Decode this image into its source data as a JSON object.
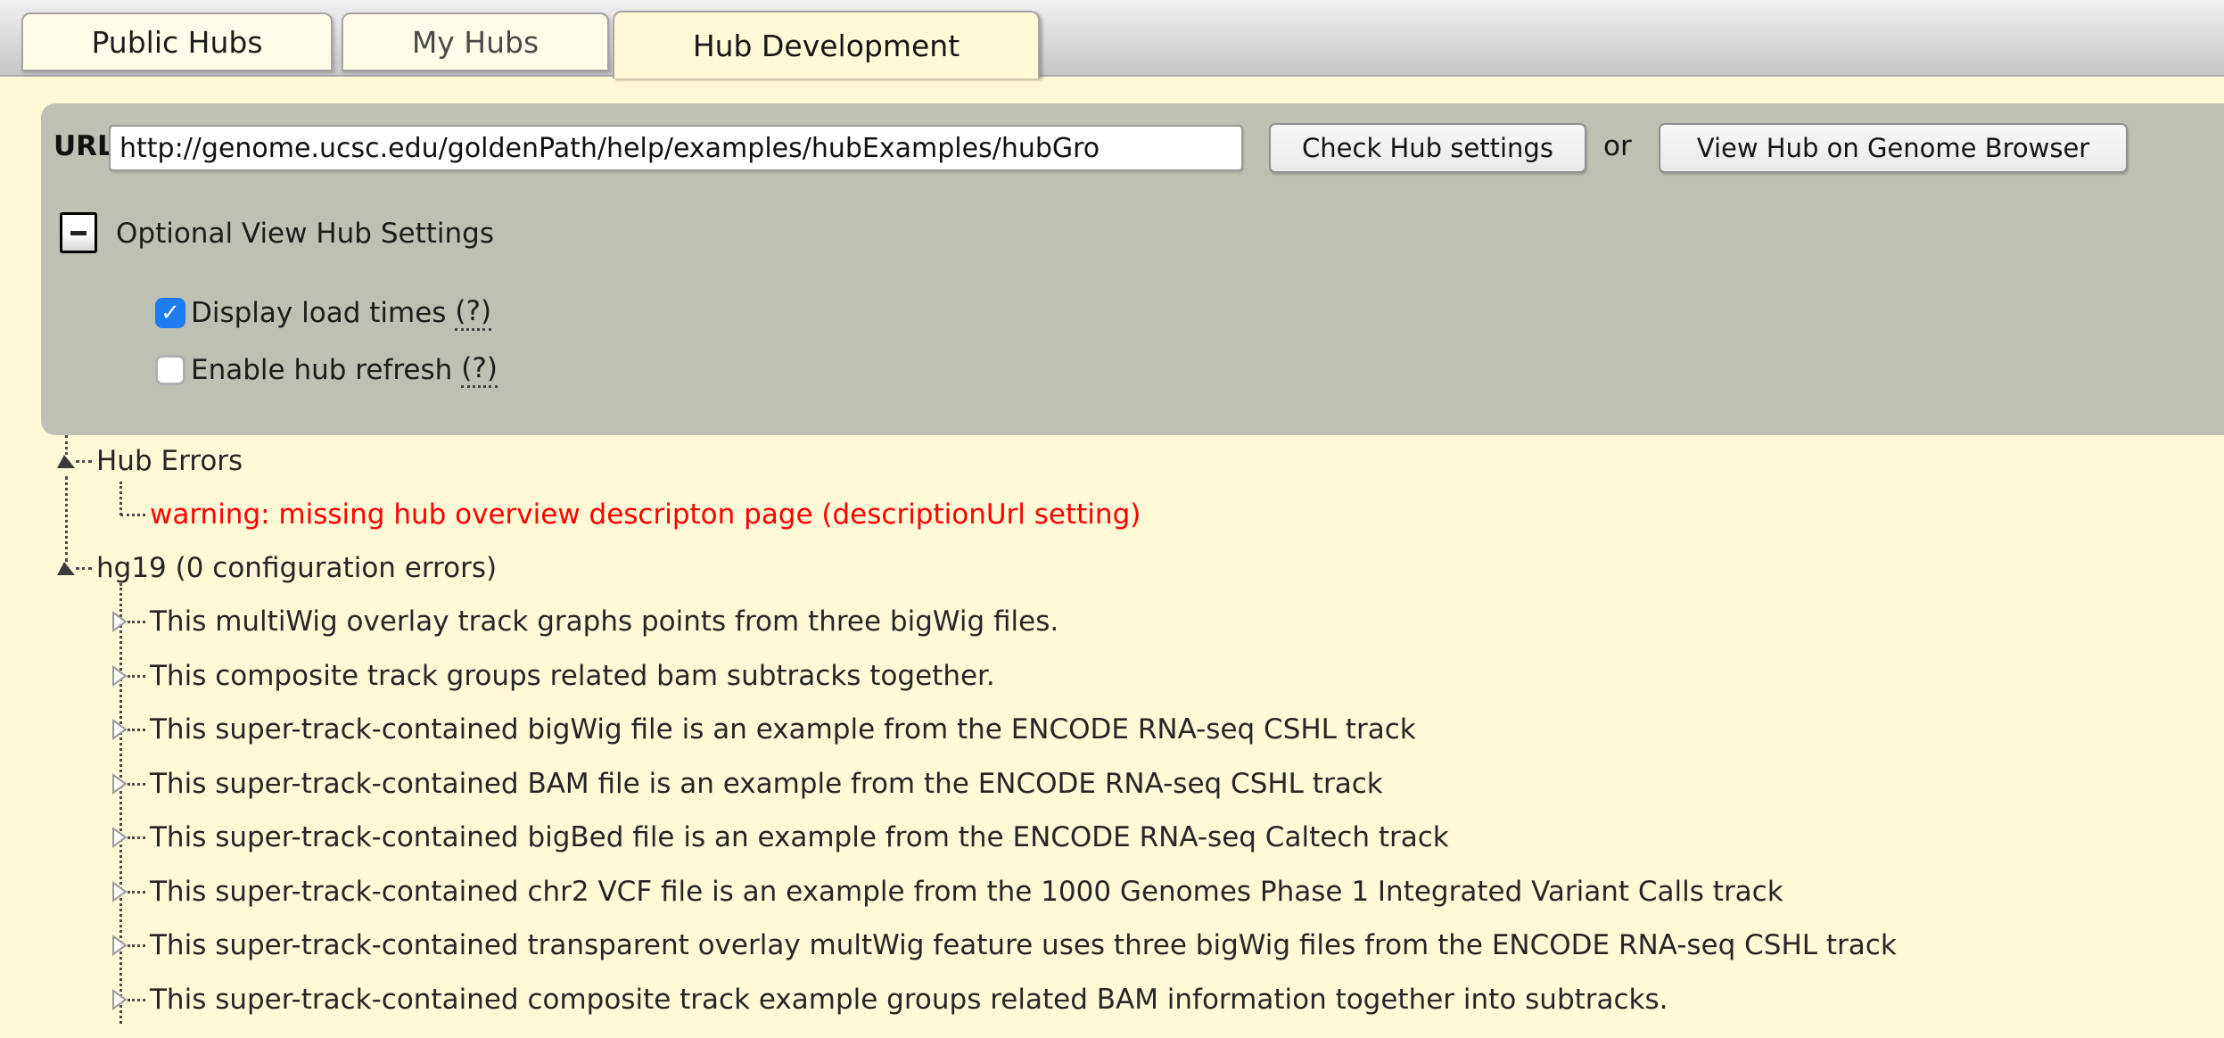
{
  "tabs": {
    "items": [
      {
        "label": "Public Hubs",
        "active": false
      },
      {
        "label": "My Hubs",
        "active": false
      },
      {
        "label": "Hub Development",
        "active": true
      }
    ]
  },
  "url_bar": {
    "label": "URL:",
    "value": "http://genome.ucsc.edu/goldenPath/help/examples/hubExamples/hubGro",
    "check_button": "Check Hub settings",
    "or_text": "or",
    "view_button": "View Hub on Genome Browser"
  },
  "settings": {
    "title": "Optional View Hub Settings",
    "collapse_state": "expanded",
    "checkboxes": [
      {
        "label": "Display load times",
        "help": "(?)",
        "checked": true
      },
      {
        "label": "Enable hub refresh",
        "help": "(?)",
        "checked": false
      }
    ]
  },
  "tree": {
    "hub_errors": {
      "label": "Hub Errors",
      "state": "expanded"
    },
    "hub_errors_children": [
      {
        "label": "warning: missing hub overview descripton page (descriptionUrl setting)"
      }
    ],
    "genome": {
      "label": "hg19 (0 configuration errors)",
      "state": "expanded"
    },
    "genome_children": [
      {
        "label": "This multiWig overlay track graphs points from three bigWig files."
      },
      {
        "label": "This composite track groups related bam subtracks together."
      },
      {
        "label": "This super-track-contained bigWig file is an example from the ENCODE RNA-seq CSHL track"
      },
      {
        "label": "This super-track-contained BAM file is an example from the ENCODE RNA-seq CSHL track"
      },
      {
        "label": "This super-track-contained bigBed file is an example from the ENCODE RNA-seq Caltech track"
      },
      {
        "label": "This super-track-contained chr2 VCF file is an example from the 1000 Genomes Phase 1 Integrated Variant Calls track"
      },
      {
        "label": "This super-track-contained transparent overlay multWig feature uses three bigWig files from the ENCODE RNA-seq CSHL track"
      },
      {
        "label": "This super-track-contained composite track example groups related BAM information together into subtracks."
      }
    ]
  },
  "icons": {
    "check": "✓",
    "minus": "−",
    "expanded_arrow": "filled dark triangle",
    "collapsed_arrow": "hollow right triangle"
  },
  "colors": {
    "page_bg": "#FFF9D5",
    "panel_bg": "#BEC0B3",
    "tab_inactive_bg": "#FFFDE9",
    "checkbox_blue": "#1E7BF0",
    "warning_red": "#FF0000"
  }
}
